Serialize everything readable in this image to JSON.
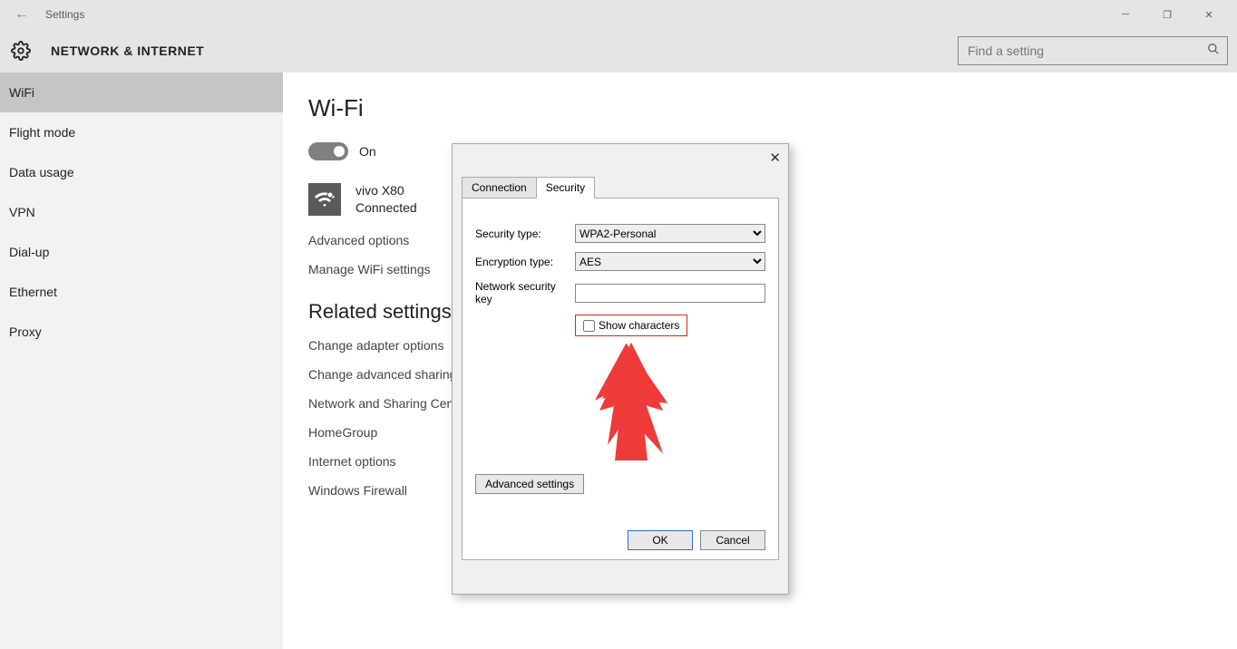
{
  "window": {
    "title": "Settings"
  },
  "header": {
    "label": "NETWORK & INTERNET",
    "search_placeholder": "Find a setting"
  },
  "sidebar": {
    "items": [
      {
        "label": "WiFi",
        "active": true
      },
      {
        "label": "Flight mode"
      },
      {
        "label": "Data usage"
      },
      {
        "label": "VPN"
      },
      {
        "label": "Dial-up"
      },
      {
        "label": "Ethernet"
      },
      {
        "label": "Proxy"
      }
    ]
  },
  "content": {
    "title": "Wi-Fi",
    "toggle_state": "On",
    "network": {
      "name": "vivo X80",
      "status": "Connected"
    },
    "links1": [
      "Advanced options",
      "Manage WiFi settings"
    ],
    "related_heading": "Related settings",
    "links2": [
      "Change adapter options",
      "Change advanced sharing options",
      "Network and Sharing Centre",
      "HomeGroup",
      "Internet options",
      "Windows Firewall"
    ]
  },
  "dialog": {
    "tabs": [
      "Connection",
      "Security"
    ],
    "active_tab": 1,
    "security_type_label": "Security type:",
    "security_type_value": "WPA2-Personal",
    "encryption_label": "Encryption type:",
    "encryption_value": "AES",
    "key_label": "Network security key",
    "key_value": "",
    "show_chars_label": "Show characters",
    "advanced_btn": "Advanced settings",
    "ok": "OK",
    "cancel": "Cancel"
  }
}
